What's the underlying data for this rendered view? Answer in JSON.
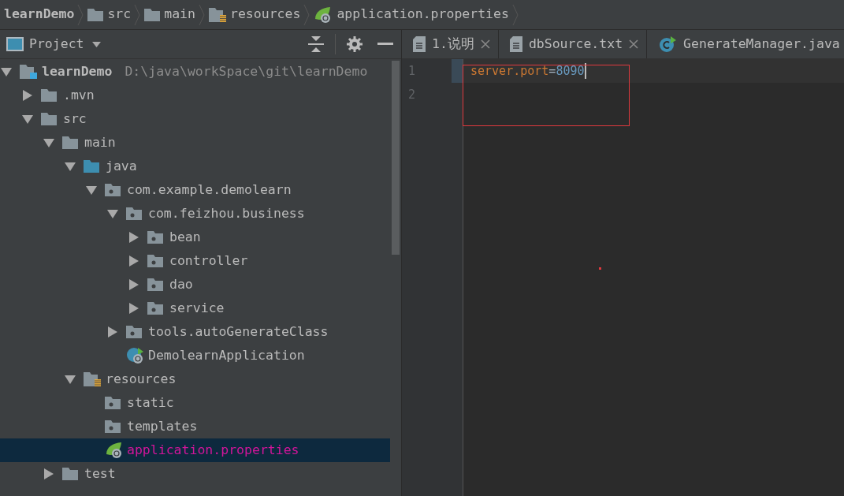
{
  "breadcrumbs": [
    {
      "label": "learnDemo"
    },
    {
      "label": "src",
      "kind": "folder"
    },
    {
      "label": "main",
      "kind": "folder"
    },
    {
      "label": "resources",
      "kind": "resources"
    },
    {
      "label": "application.properties",
      "kind": "spring-properties"
    }
  ],
  "project_panel": {
    "title": "Project"
  },
  "tree": [
    {
      "label": "learnDemo",
      "path": "D:\\java\\workSpace\\git\\learnDemo",
      "kind": "module",
      "expanded": true,
      "selected": false,
      "children": [
        {
          "label": ".mvn",
          "kind": "folder",
          "expanded": false,
          "selected": false
        },
        {
          "label": "src",
          "kind": "folder",
          "expanded": true,
          "selected": false,
          "children": [
            {
              "label": "main",
              "kind": "folder",
              "expanded": true,
              "selected": false,
              "children": [
                {
                  "label": "java",
                  "kind": "source",
                  "expanded": true,
                  "selected": false,
                  "children": [
                    {
                      "label": "com.example.demolearn",
                      "kind": "package",
                      "expanded": true,
                      "selected": false,
                      "children": [
                        {
                          "label": "com.feizhou.business",
                          "kind": "package",
                          "expanded": true,
                          "selected": false,
                          "children": [
                            {
                              "label": "bean",
                              "kind": "package",
                              "expanded": false,
                              "selected": false
                            },
                            {
                              "label": "controller",
                              "kind": "package",
                              "expanded": false,
                              "selected": false
                            },
                            {
                              "label": "dao",
                              "kind": "package",
                              "expanded": false,
                              "selected": false
                            },
                            {
                              "label": "service",
                              "kind": "package",
                              "expanded": false,
                              "selected": false
                            }
                          ]
                        },
                        {
                          "label": "tools.autoGenerateClass",
                          "kind": "package",
                          "expanded": false,
                          "selected": false
                        },
                        {
                          "label": "DemolearnApplication",
                          "kind": "spring-class",
                          "selected": false
                        }
                      ]
                    }
                  ]
                },
                {
                  "label": "resources",
                  "kind": "resources",
                  "expanded": true,
                  "selected": false,
                  "children": [
                    {
                      "label": "static",
                      "kind": "package",
                      "selected": false
                    },
                    {
                      "label": "templates",
                      "kind": "package",
                      "selected": false
                    },
                    {
                      "label": "application.properties",
                      "kind": "spring-properties",
                      "selected": true
                    }
                  ]
                }
              ]
            },
            {
              "label": "test",
              "kind": "folder",
              "expanded": false,
              "selected": false
            }
          ]
        }
      ]
    }
  ],
  "tabs": [
    {
      "label": "1.说明",
      "kind": "text",
      "closable": true,
      "selected": false
    },
    {
      "label": "dbSource.txt",
      "kind": "text",
      "closable": true,
      "selected": false
    },
    {
      "label": "GenerateManager.java",
      "kind": "class",
      "closable": false,
      "selected": false
    }
  ],
  "editor": {
    "lines": [
      {
        "number": "1",
        "key": "server.port",
        "sep": "=",
        "value": "8090",
        "current": true
      },
      {
        "number": "2",
        "current": false
      }
    ]
  }
}
